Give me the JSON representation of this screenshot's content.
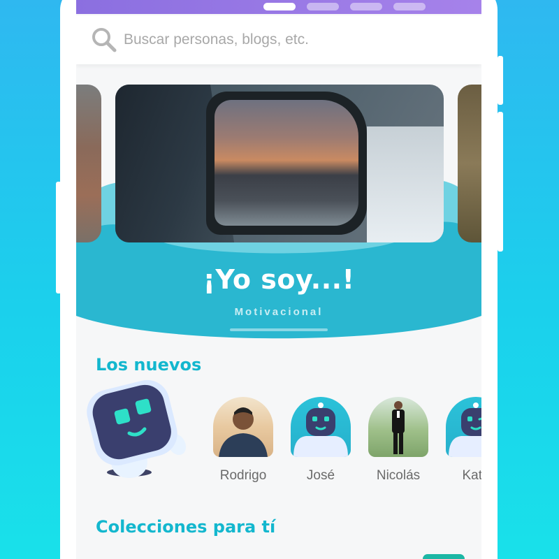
{
  "search": {
    "placeholder": "Buscar personas, blogs, etc."
  },
  "carousel": {
    "pages": 4,
    "active_page": 1,
    "featured": {
      "title": "¡Yo soy...!",
      "category": "Motivacional"
    }
  },
  "new_users": {
    "heading": "Los nuevos",
    "users": [
      {
        "name": "Rodrigo",
        "avatar": "photo"
      },
      {
        "name": "José",
        "avatar": "robot"
      },
      {
        "name": "Nicolás",
        "avatar": "photo"
      },
      {
        "name": "Kath",
        "avatar": "robot"
      }
    ]
  },
  "collections": {
    "heading": "Colecciones para tí"
  },
  "colors": {
    "accent": "#13b7ce",
    "wave": "#2ab7d0",
    "topbar": "#9b7ae6",
    "mascot": "#3a3f6e",
    "mascot_face": "#2ee0c8"
  },
  "icons": {
    "search": "search-icon"
  }
}
